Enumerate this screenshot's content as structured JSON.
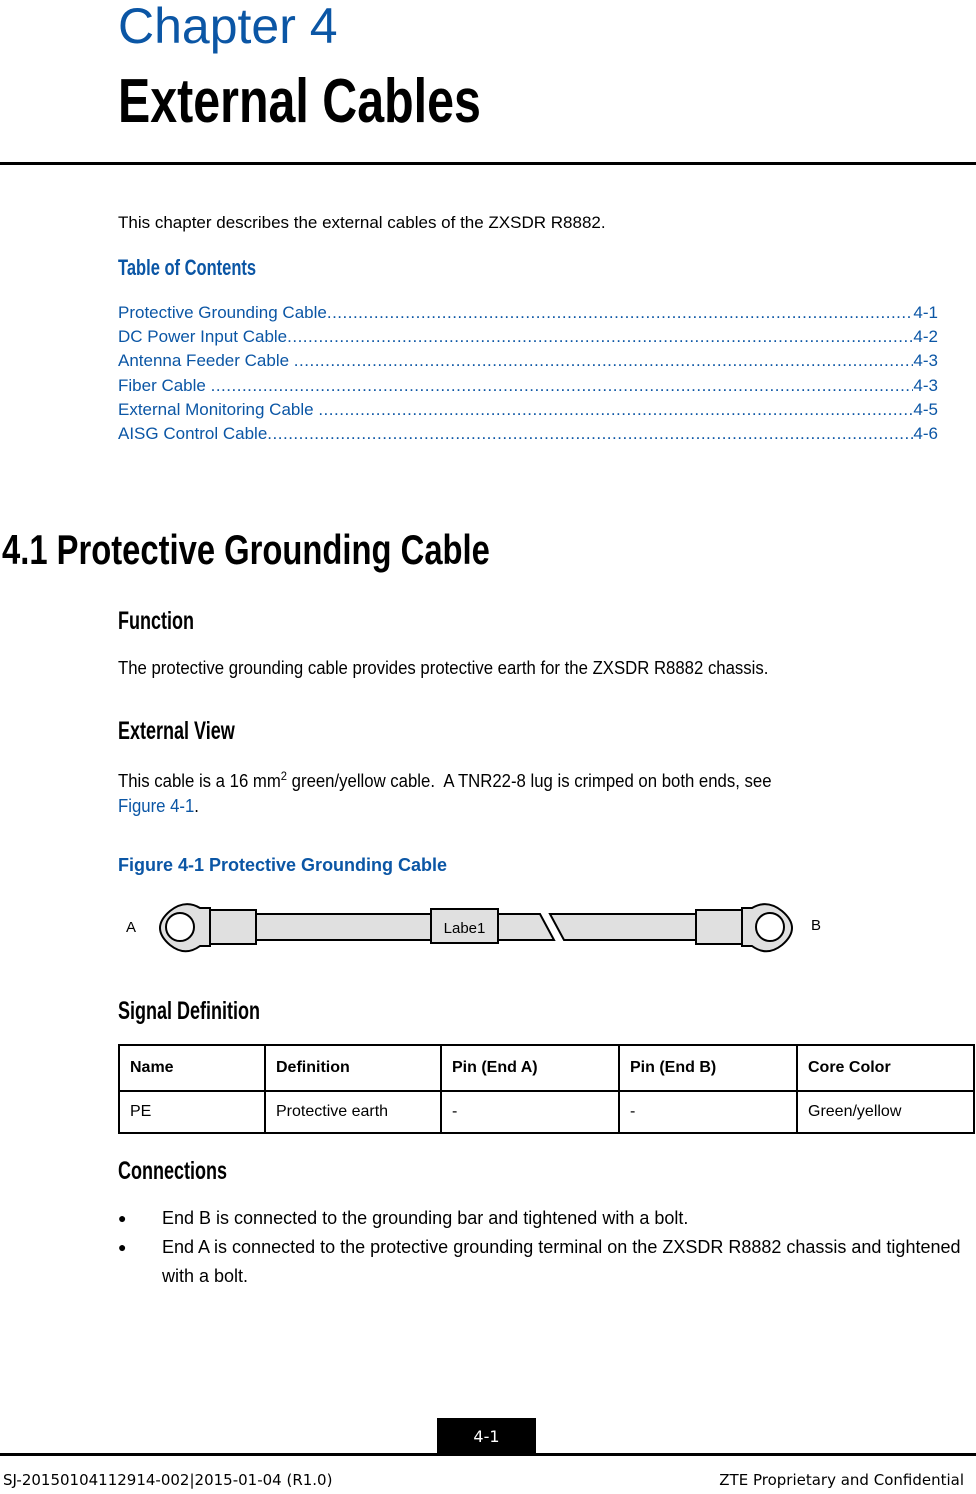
{
  "chapter": {
    "label": "Chapter 4",
    "title": "External Cables",
    "intro": "This chapter describes the external cables of the ZXSDR R8882."
  },
  "toc": {
    "heading": "Table of Contents",
    "items": [
      {
        "title": "Protective Grounding Cable",
        "page": "4-1"
      },
      {
        "title": "DC Power Input Cable",
        "page": "4-2"
      },
      {
        "title": "Antenna Feeder Cable ",
        "page": "4-3"
      },
      {
        "title": "Fiber Cable ",
        "page": "4-3"
      },
      {
        "title": "External Monitoring Cable ",
        "page": "4-5"
      },
      {
        "title": "AISG Control Cable",
        "page": "4-6"
      }
    ]
  },
  "section": {
    "title": "4.1 Protective Grounding Cable",
    "function": {
      "heading": "Function",
      "text": "The protective grounding cable provides protective earth for the ZXSDR R8882 chassis."
    },
    "external_view": {
      "heading": "External View",
      "text_before_sup": "This cable is a 16 mm",
      "sup": "2",
      "text_after_sup": " green/yellow cable.  A TNR22-8 lug is crimped on both ends, see",
      "link": "Figure 4-1",
      "link_suffix": "."
    },
    "figure": {
      "caption": "Figure 4-1 Protective Grounding Cable",
      "end_a": "A",
      "end_b": "B",
      "label": "Labe1"
    },
    "signal_definition": {
      "heading": "Signal Definition",
      "columns": [
        "Name",
        "Definition",
        "Pin (End A)",
        "Pin (End B)",
        "Core Color"
      ],
      "rows": [
        [
          "PE",
          "Protective earth",
          "-",
          "-",
          "Green/yellow"
        ]
      ]
    },
    "connections": {
      "heading": "Connections",
      "bullet_glyph": "●",
      "items": [
        "End B is connected to the grounding bar and tightened with a bolt.",
        "End A is connected to the protective grounding terminal on the ZXSDR R8882 chassis and tightened with a bolt."
      ]
    }
  },
  "footer": {
    "page_number": "4-1",
    "doc_id": "SJ-20150104112914-002|2015-01-04 (R1.0)",
    "confidentiality": "ZTE Proprietary and Confidential"
  },
  "colors": {
    "accent_blue": "#0b56a5",
    "figure_fill": "#e0e0e0"
  }
}
